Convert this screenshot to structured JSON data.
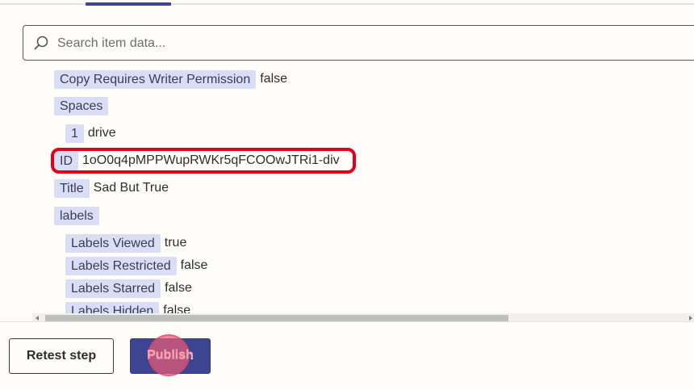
{
  "search": {
    "placeholder": "Search item data..."
  },
  "tree": {
    "partial_top": {
      "key": "Copy Requires Writer Permission",
      "value": "false"
    },
    "spaces": {
      "key": "Spaces",
      "item_key": "1",
      "item_value": "drive"
    },
    "id": {
      "key": "ID",
      "value": "1oO0q4pMPPWupRWKr5qFCOOwJTRi1-div"
    },
    "title": {
      "key": "Title",
      "value": "Sad But True"
    },
    "labels": {
      "key": "labels",
      "items": [
        {
          "key": "Labels Viewed",
          "value": "true"
        },
        {
          "key": "Labels Restricted",
          "value": "false"
        },
        {
          "key": "Labels Starred",
          "value": "false"
        },
        {
          "key": "Labels Hidden",
          "value": "false"
        }
      ]
    }
  },
  "footer": {
    "retest_label": "Retest step",
    "publish_label": "Publish"
  },
  "colors": {
    "accent": "#3d4592",
    "key_bg": "#d9ddf5",
    "highlight": "#e2001a",
    "click_marker": "#e85c76"
  }
}
